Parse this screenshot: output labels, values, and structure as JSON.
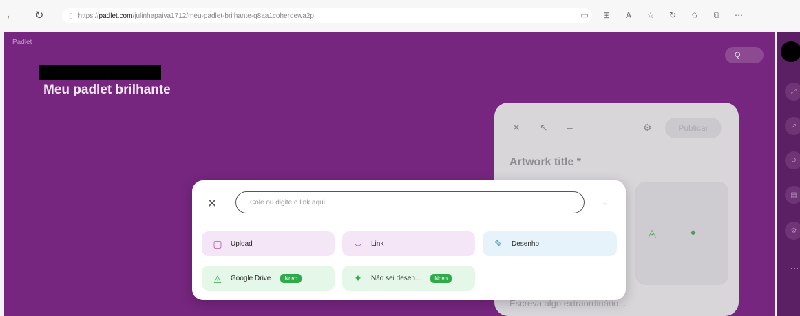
{
  "browser": {
    "url_prefix": "https://",
    "url_host": "padlet.com",
    "url_path": "/julinhapaiva1712/meu-padlet-brilhante-q8aa1coherdewa2p",
    "icons": [
      "tab-icon",
      "grid-icon",
      "read-aloud-icon",
      "favorite-icon",
      "refresh-icon",
      "favorites-bar-icon",
      "collections-icon",
      "more-icon"
    ]
  },
  "board": {
    "brand": "Padlet",
    "title": "Meu padlet brilhante",
    "search_icon": "Q"
  },
  "composer": {
    "publish_label": "Publicar",
    "artwork_title_label": "Artwork title *",
    "body_placeholder": "Escreva algo extraordinário..."
  },
  "picker": {
    "link_placeholder": "Cole ou digite o link aqui",
    "options": [
      {
        "label": "Upload",
        "icon": "upload-icon",
        "style": "purple"
      },
      {
        "label": "Link",
        "icon": "link-icon",
        "style": "purple"
      },
      {
        "label": "Desenho",
        "icon": "pen-icon",
        "style": "blue"
      },
      {
        "label": "Google Drive",
        "icon": "google-drive-icon",
        "style": "green",
        "badge": "Novo"
      },
      {
        "label": "Não sei desen...",
        "icon": "sparkle-icon",
        "style": "green",
        "badge": "Novo"
      }
    ]
  },
  "colors": {
    "board_background": "#76267f",
    "accent_green": "#2fab4b"
  }
}
